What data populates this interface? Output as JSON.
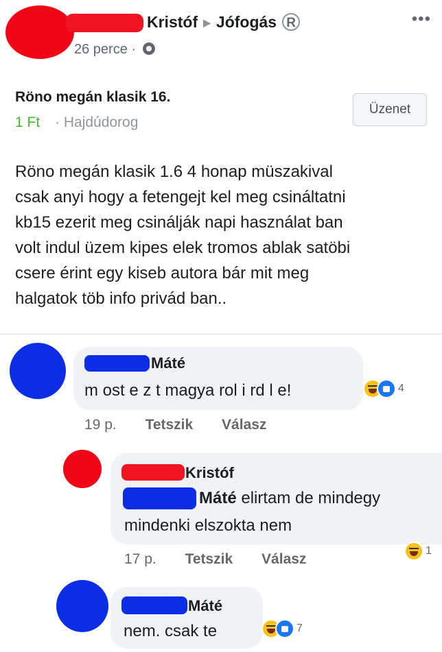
{
  "post": {
    "poster_name": "Kristóf",
    "group_name": "Jófogás",
    "group_badge": "R",
    "time": "26 perce",
    "visibility_icon": "globe-icon",
    "more_icon": "•••",
    "item_title": "Röno megán klasik 16.",
    "price": "1 Ft",
    "location": "Hajdúdorog",
    "message_button": "Üzenet",
    "body": "Röno megán klasik 1.6 4 honap müszakival\ncsak anyi hogy a fetengejt kel meg csináltatni\nkb15 ezerit meg csinálják napi használat ban\nvolt indul üzem kipes elek tromos ablak satöbi\ncsere érint egy kiseb autora bár mit meg\nhalgatok töb info privád ban.."
  },
  "comments": [
    {
      "name": "Máté",
      "text": "m ost e z t magya rol i rd l e!",
      "time": "19 p.",
      "like": "Tetszik",
      "reply": "Válasz",
      "reaction_count": "4"
    },
    {
      "name": "Kristóf",
      "mention": "Máté",
      "text_line1": "elirtam de mindegy",
      "text_line2": "mindenki elszokta nem",
      "time": "17 p.",
      "like": "Tetszik",
      "reply": "Válasz",
      "reaction_count": "1"
    },
    {
      "name": "Máté",
      "text": "nem. csak te",
      "reaction_count": "7"
    }
  ],
  "colors": {
    "redaction_red": "#f00616",
    "redaction_blue": "#0b2de6",
    "price_green": "#42b72a"
  }
}
